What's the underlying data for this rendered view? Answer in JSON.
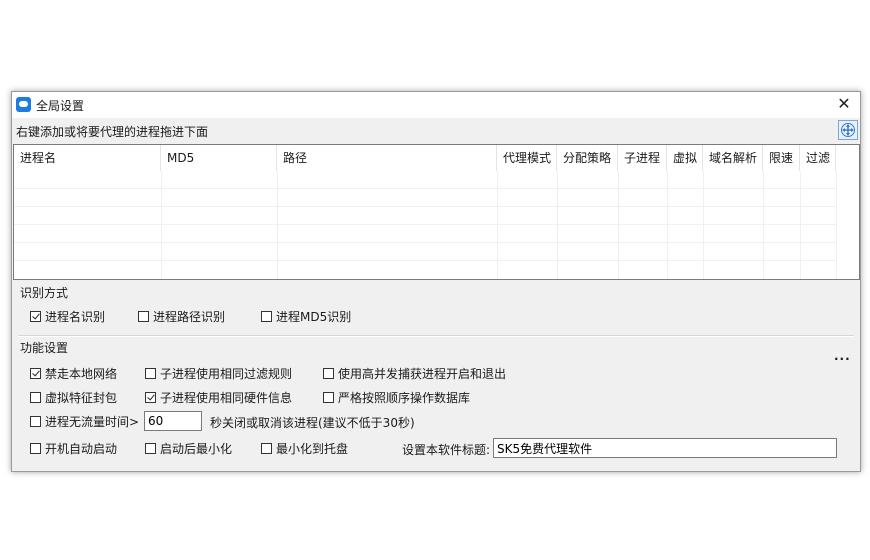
{
  "window": {
    "title": "全局设置",
    "close": "✕"
  },
  "hint": "右键添加或将要代理的进程拖进下面",
  "table": {
    "columns": [
      "进程名",
      "MD5",
      "路径",
      "代理模式",
      "分配策略",
      "子进程",
      "虚拟",
      "域名解析",
      "限速",
      "过滤"
    ],
    "rows": []
  },
  "identify": {
    "title": "识别方式",
    "options": [
      {
        "label": "进程名识别",
        "checked": true
      },
      {
        "label": "进程路径识别",
        "checked": false
      },
      {
        "label": "进程MD5识别",
        "checked": false
      }
    ]
  },
  "features": {
    "title": "功能设置",
    "more": "...",
    "row1": [
      {
        "label": "禁走本地网络",
        "checked": true
      },
      {
        "label": "子进程使用相同过滤规则",
        "checked": false
      },
      {
        "label": "使用高并发捕获进程开启和退出",
        "checked": false
      }
    ],
    "row2": [
      {
        "label": "虚拟特征封包",
        "checked": false
      },
      {
        "label": "子进程使用相同硬件信息",
        "checked": true
      },
      {
        "label": "严格按照顺序操作数据库",
        "checked": false
      }
    ],
    "idle": {
      "label": "进程无流量时间>",
      "checked": false,
      "value": "60",
      "suffix": "秒关闭或取消该进程(建议不低于30秒)"
    },
    "row4": [
      {
        "label": "开机自动启动",
        "checked": false
      },
      {
        "label": "启动后最小化",
        "checked": false
      },
      {
        "label": "最小化到托盘",
        "checked": false
      }
    ],
    "title_setting": {
      "label": "设置本软件标题:",
      "value": "SK5免费代理软件"
    }
  },
  "icons": {
    "app": "chat-bubble-icon",
    "move": "move-arrows-icon"
  }
}
